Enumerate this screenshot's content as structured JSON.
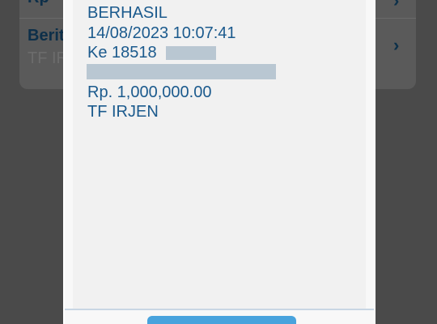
{
  "background": {
    "row1_label": "Rp",
    "row2_label": "Berita",
    "row2_value": "TF IRJEN"
  },
  "modal": {
    "status": "BERHASIL",
    "datetime": "14/08/2023 10:07:41",
    "recipient_prefix": "Ke 18518",
    "amount": "Rp. 1,000,000.00",
    "note": "TF IRJEN"
  },
  "colors": {
    "text_blue": "#1b5a8d",
    "redaction": "#b9c7d2",
    "button": "#48a3dd"
  }
}
